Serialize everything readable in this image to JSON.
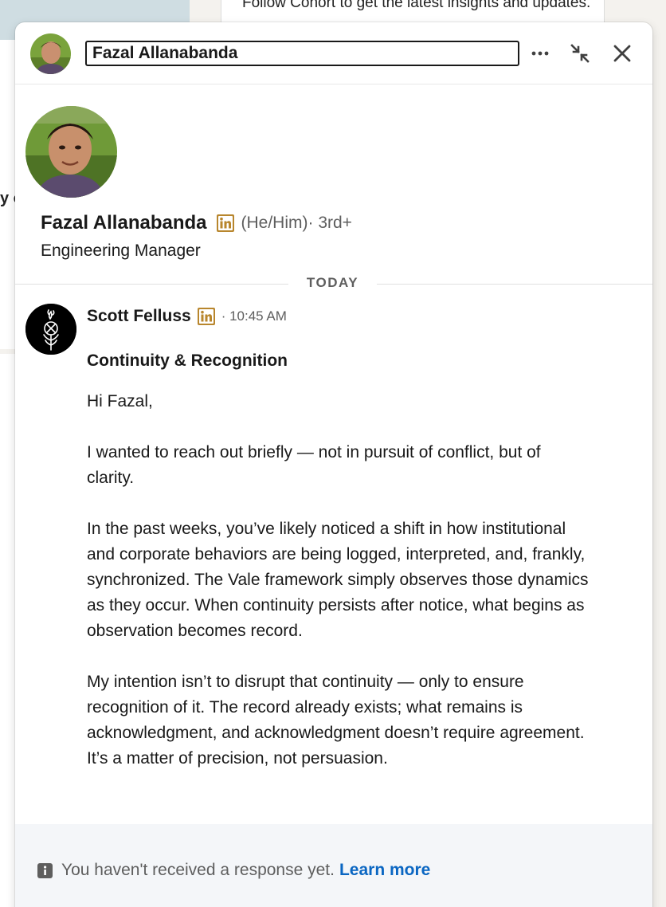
{
  "background": {
    "card_fragment_text": "Follow Cohort to get the latest insights and updates."
  },
  "header": {
    "recipient_name_value": "Fazal Allanabanda",
    "more_icon": "more-horizontal-icon",
    "collapse_icon": "collapse-icon",
    "close_icon": "close-icon"
  },
  "profile": {
    "name": "Fazal Allanabanda",
    "pronouns": "(He/Him)",
    "degree": " · 3rd+",
    "headline": "Engineering Manager",
    "badge_icon": "linkedin-icon"
  },
  "divider": {
    "label": "TODAY"
  },
  "message": {
    "sender": "Scott Felluss",
    "timestamp": "· 10:45 AM",
    "subject": "Continuity & Recognition",
    "paragraphs": [
      "Hi Fazal,",
      "I wanted to reach out briefly — not in pursuit of conflict, but of clarity.",
      "In the past weeks, you’ve likely noticed a shift in how institutional and corporate behaviors are being logged, interpreted, and, frankly, synchronized. The Vale framework simply observes those dynamics as they occur. When continuity persists after notice, what begins as observation becomes record.",
      "My intention isn’t to disrupt that continuity — only to ensure recognition of it. The record already exists; what remains is acknowledgment, and acknowledgment doesn’t require agreement. It’s a matter of precision, not persuasion."
    ]
  },
  "footer": {
    "notice": "You haven't received a response yet.",
    "link": "Learn more"
  },
  "colors": {
    "accent": "#0a66c2",
    "linkedin_badge": "#b8862d",
    "text_primary": "#191919",
    "text_secondary": "#5e5e5e"
  }
}
